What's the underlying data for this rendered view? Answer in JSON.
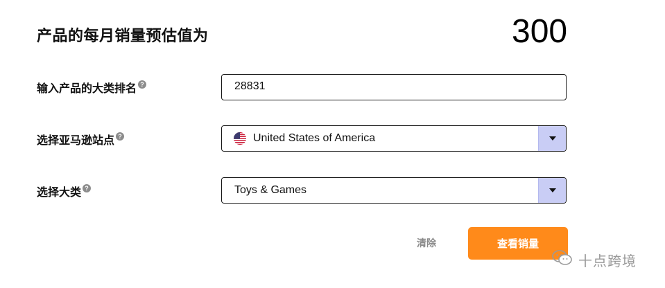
{
  "header": {
    "title": "产品的每月销量预估值为",
    "estimate_value": "300"
  },
  "form": {
    "rank": {
      "label": "输入产品的大类排名",
      "value": "28831",
      "help_icon": "question-circle-icon"
    },
    "marketplace": {
      "label": "选择亚马逊站点",
      "selected": "United States of America",
      "flag_icon": "us-flag-icon",
      "help_icon": "question-circle-icon"
    },
    "category": {
      "label": "选择大类",
      "selected": "Toys & Games",
      "help_icon": "question-circle-icon"
    }
  },
  "actions": {
    "clear_label": "清除",
    "submit_label": "查看销量"
  },
  "watermark": {
    "text": "十点跨境",
    "icon": "wechat-icon"
  },
  "colors": {
    "accent": "#ff8a1a",
    "dropdown_arrow_bg": "#c9cdf5",
    "muted_text": "#8a8a8a"
  }
}
